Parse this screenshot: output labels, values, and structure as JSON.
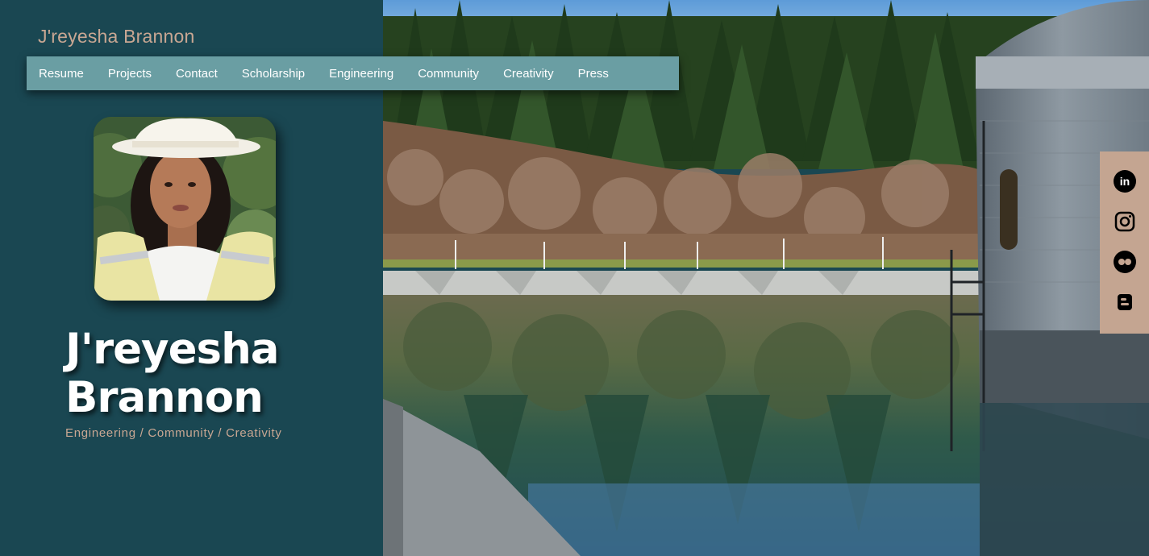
{
  "site": {
    "title": "J'reyesha Brannon"
  },
  "nav": {
    "items": [
      {
        "label": "Resume"
      },
      {
        "label": "Projects"
      },
      {
        "label": "Contact"
      },
      {
        "label": "Scholarship"
      },
      {
        "label": "Engineering"
      },
      {
        "label": "Community"
      },
      {
        "label": "Creativity"
      },
      {
        "label": "Press"
      }
    ]
  },
  "hero": {
    "name_line1": "J'reyesha",
    "name_line2": "Brannon",
    "tagline": "Engineering / Community / Creativity"
  },
  "social": {
    "icons": [
      "linkedin-icon",
      "instagram-icon",
      "flickr-icon",
      "blogger-icon"
    ]
  },
  "colors": {
    "panel": "#1a4752",
    "nav": "#6a9ea3",
    "accent": "#c9a793",
    "social_bar": "#c4a591"
  }
}
